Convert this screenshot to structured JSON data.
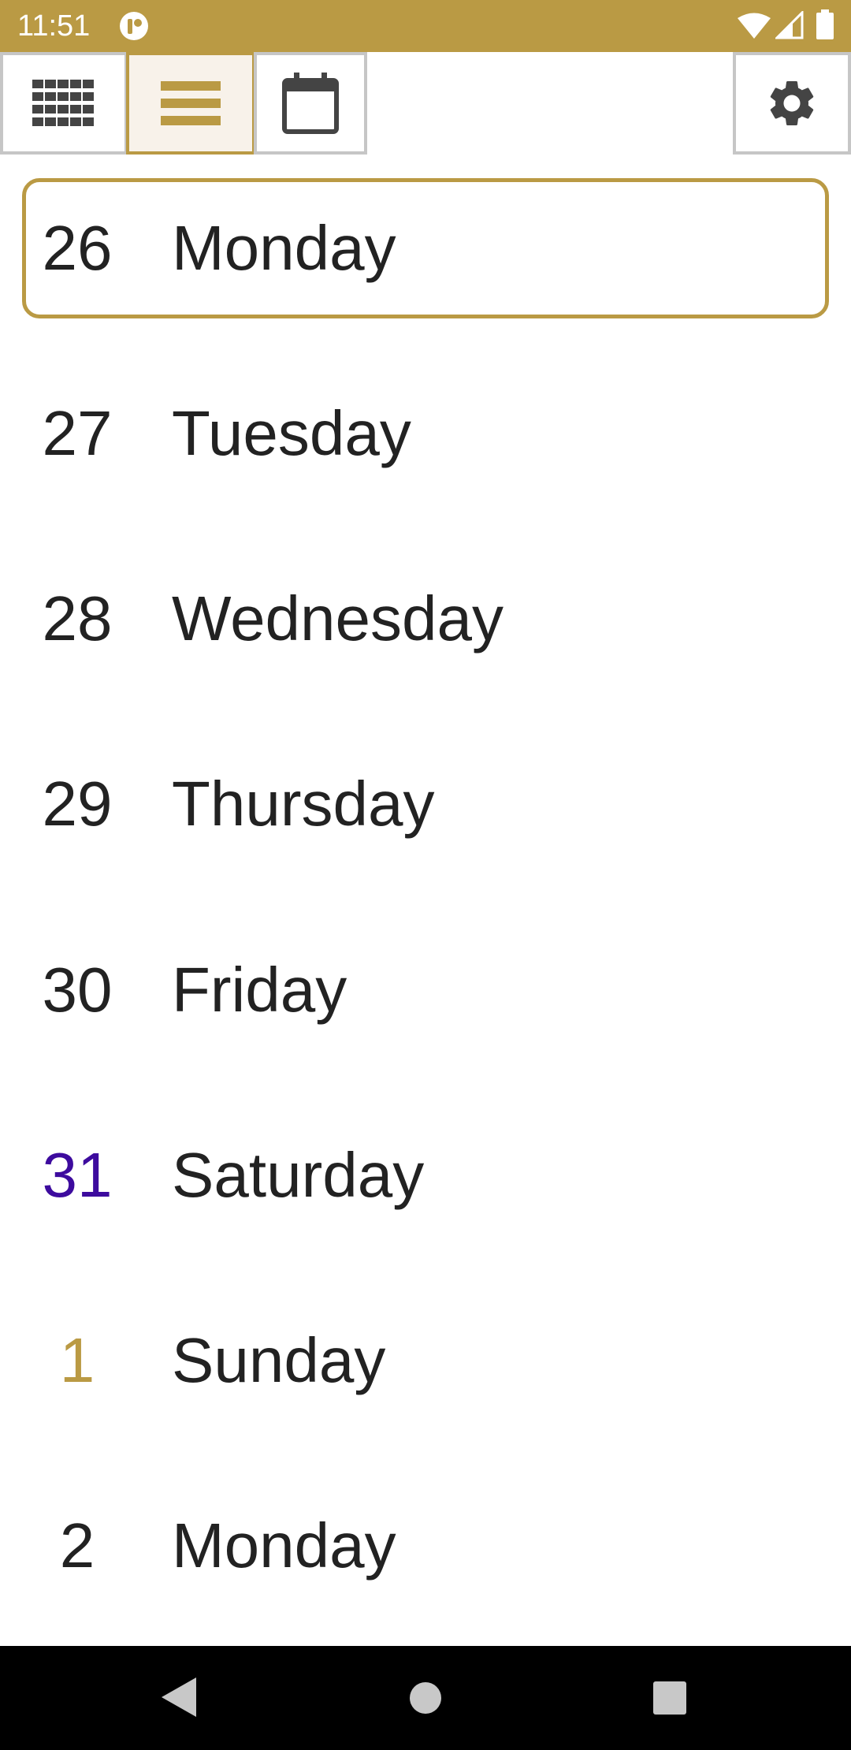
{
  "status_bar": {
    "time": "11:51",
    "color": "#BA9A44",
    "icons": [
      "app-notification-icon",
      "wifi-icon",
      "signal-icon",
      "battery-icon"
    ]
  },
  "toolbar": {
    "buttons": [
      {
        "name": "grid-view",
        "icon": "grid-icon",
        "active": false
      },
      {
        "name": "list-view",
        "icon": "list-icon",
        "active": true
      },
      {
        "name": "calendar-view",
        "icon": "calendar-icon",
        "active": false
      },
      {
        "name": "settings",
        "icon": "gear-icon",
        "active": false
      }
    ],
    "accent_color": "#BA9A44",
    "active_bg": "#F8F2EA"
  },
  "days": [
    {
      "day": "26",
      "name": "Monday",
      "selected": true,
      "num_color": "#222222"
    },
    {
      "day": "27",
      "name": "Tuesday",
      "selected": false,
      "num_color": "#222222"
    },
    {
      "day": "28",
      "name": "Wednesday",
      "selected": false,
      "num_color": "#222222"
    },
    {
      "day": "29",
      "name": "Thursday",
      "selected": false,
      "num_color": "#222222"
    },
    {
      "day": "30",
      "name": "Friday",
      "selected": false,
      "num_color": "#222222"
    },
    {
      "day": "31",
      "name": "Saturday",
      "selected": false,
      "num_color": "#3D0B9E"
    },
    {
      "day": "1",
      "name": "Sunday",
      "selected": false,
      "num_color": "#BA9A44"
    },
    {
      "day": "2",
      "name": "Monday",
      "selected": false,
      "num_color": "#222222"
    }
  ],
  "nav_bar": {
    "icons": [
      "back-icon",
      "home-icon",
      "recents-icon"
    ]
  }
}
